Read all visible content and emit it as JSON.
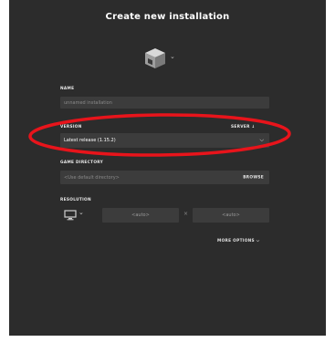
{
  "dialog": {
    "title": "Create new installation"
  },
  "icons": {
    "installation_icon": "furnace-block-icon",
    "chevron": "chevron-down-icon",
    "monitor": "monitor-icon"
  },
  "name": {
    "label": "NAME",
    "placeholder": "unnamed installation"
  },
  "version": {
    "label": "VERSION",
    "server_label": "SERVER ↓",
    "selected": "Latest release (1.15.2)"
  },
  "game_directory": {
    "label": "GAME DIRECTORY",
    "placeholder": "<Use default directory>",
    "browse_label": "BROWSE"
  },
  "resolution": {
    "label": "RESOLUTION",
    "width_value": "<auto>",
    "separator": "×",
    "height_value": "<auto>"
  },
  "more_options": {
    "label": "MORE OPTIONS ⌵"
  },
  "annotation": {
    "color": "#e8141b"
  },
  "colors": {
    "panel": "#2c2c2c",
    "field": "#3c3c3c"
  }
}
